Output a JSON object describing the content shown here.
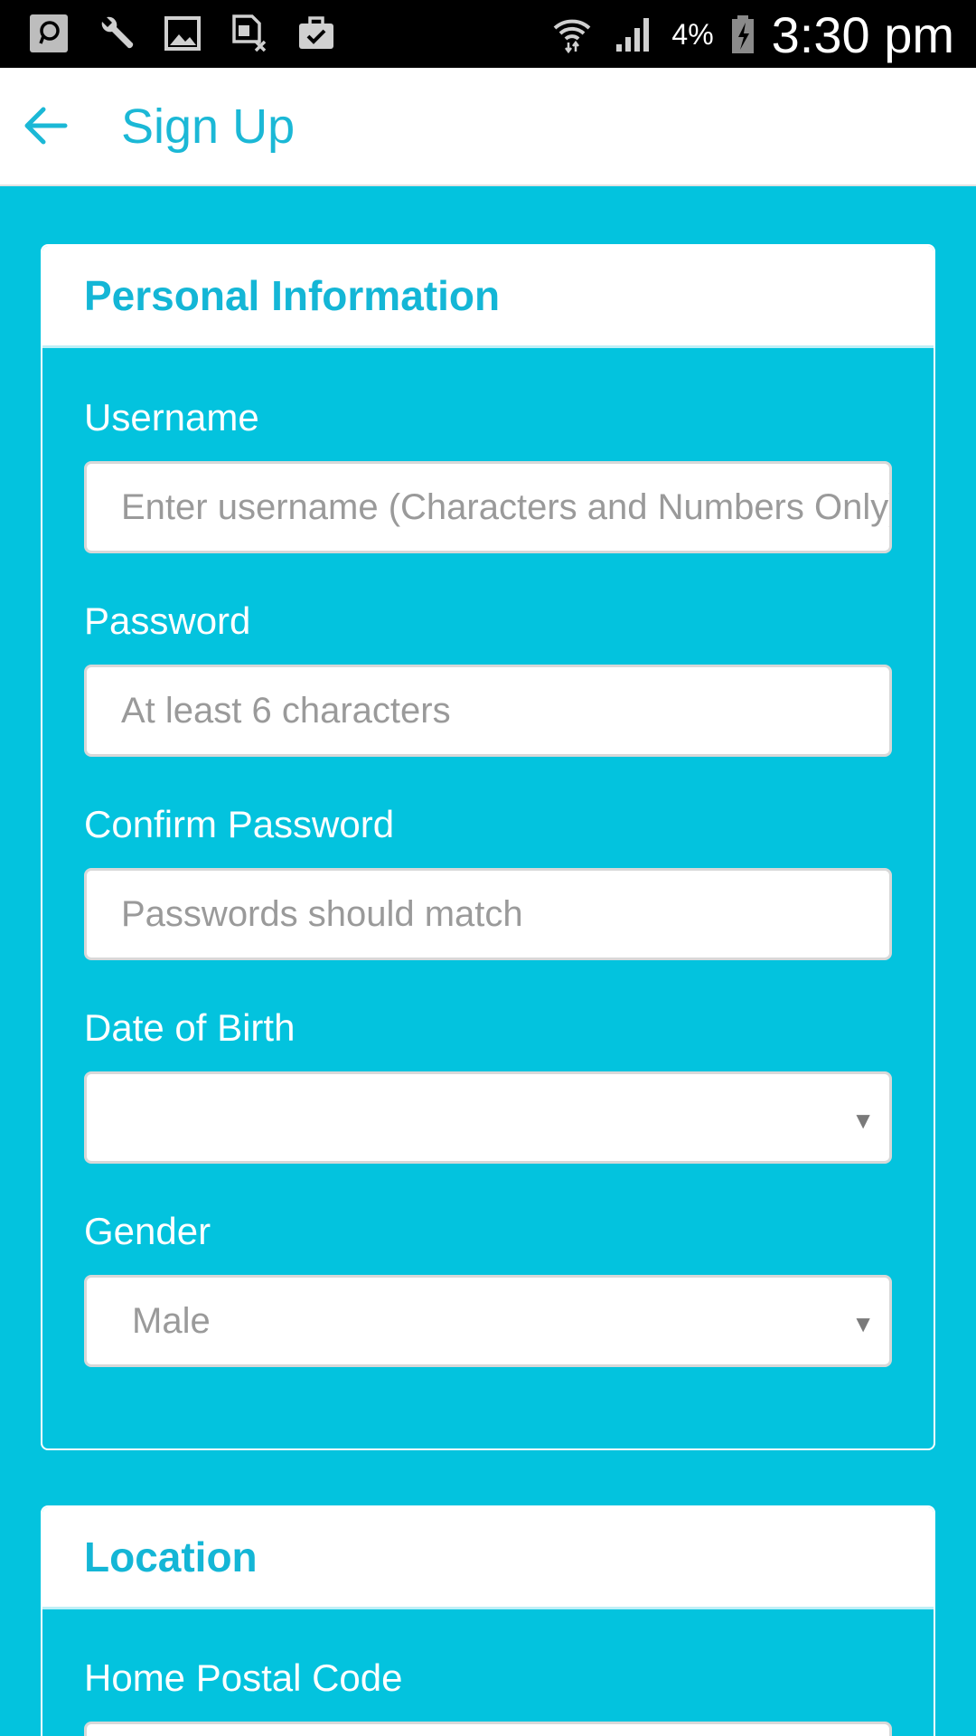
{
  "status_bar": {
    "left_icons": [
      "chat-bubble-icon",
      "wrench-icon",
      "image-icon",
      "sim-off-icon",
      "clipboard-check-icon"
    ],
    "battery_percent": "4%",
    "time": "3:30 pm"
  },
  "app_bar": {
    "title": "Sign Up"
  },
  "personal_info": {
    "title": "Personal Information",
    "username": {
      "label": "Username",
      "placeholder": "Enter username (Characters and Numbers Only)"
    },
    "password": {
      "label": "Password",
      "placeholder": "At least 6 characters"
    },
    "confirm_password": {
      "label": "Confirm Password",
      "placeholder": "Passwords should match"
    },
    "date_of_birth": {
      "label": "Date of Birth",
      "value": ""
    },
    "gender": {
      "label": "Gender",
      "value": "Male"
    }
  },
  "location": {
    "title": "Location",
    "home_postal_code": {
      "label": "Home Postal Code"
    }
  },
  "colors": {
    "accent": "#03C3DE",
    "title_text": "#1BB8D6"
  }
}
